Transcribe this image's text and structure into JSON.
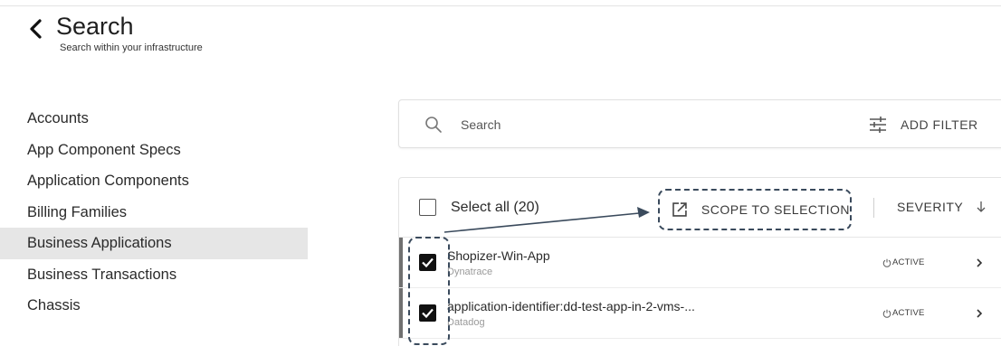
{
  "header": {
    "title": "Search",
    "subtitle": "Search within your infrastructure",
    "back_icon": "chevron-left-icon"
  },
  "sidebar": {
    "items": [
      {
        "label": "Accounts",
        "selected": false
      },
      {
        "label": "App Component Specs",
        "selected": false
      },
      {
        "label": "Application Components",
        "selected": false
      },
      {
        "label": "Billing Families",
        "selected": false
      },
      {
        "label": "Business Applications",
        "selected": true
      },
      {
        "label": "Business Transactions",
        "selected": false
      },
      {
        "label": "Chassis",
        "selected": false
      }
    ]
  },
  "search": {
    "placeholder": "Search",
    "value": "",
    "icon": "search-icon",
    "add_filter_label": "ADD FILTER",
    "filter_icon": "sliders-icon"
  },
  "toolbar": {
    "select_all_label": "Select all (20)",
    "scope_label": "SCOPE TO SELECTION",
    "scope_icon": "external-link-icon",
    "severity_label": "SEVERITY",
    "sort_icon": "arrow-down-icon"
  },
  "rows": [
    {
      "name": "Shopizer-Win-App",
      "source": "Dynatrace",
      "status": "ACTIVE",
      "checked": true
    },
    {
      "name": "application-identifier:dd-test-app-in-2-vms-...",
      "source": "Datadog",
      "status": "ACTIVE",
      "checked": true
    }
  ],
  "colors": {
    "selected_bg": "#e6e6e6",
    "annotation": "#3a4a5c",
    "row_accent": "#707070"
  }
}
